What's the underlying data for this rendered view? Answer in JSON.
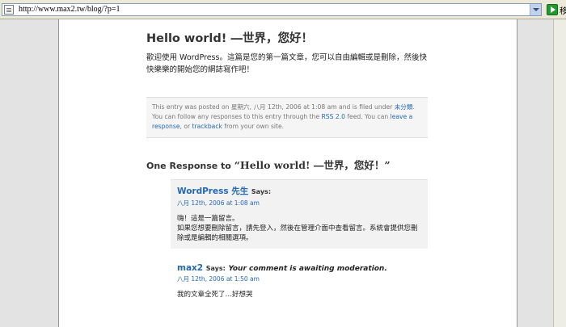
{
  "browser": {
    "url": "http://www.max2.tw/blog/?p=1",
    "go_label": "移"
  },
  "post": {
    "title": "Hello world! ―世界，您好！",
    "body": "歡迎使用 WordPress。這篇是您的第一篇文章，您可以自由編輯或是刪除，然後快快樂樂的開始您的網誌寫作吧！"
  },
  "postmeta": {
    "line1_prefix": "This entry was posted on 星期六, 八月 12th, 2006 at 1:08 am and is filed under ",
    "category": "未分類",
    "line1_suffix": ".",
    "line2_prefix": "You can follow any responses to this entry through the ",
    "rss_link": "RSS 2.0",
    "line2_mid": " feed. You can ",
    "leave_response": "leave a response",
    "line2_or": ", or ",
    "trackback": "trackback",
    "line2_suffix": " from your own site."
  },
  "responses": {
    "prefix": "One Response to ",
    "quoted_title": "“Hello world! ―世界，您好！”"
  },
  "comments": [
    {
      "author": "WordPress 先生",
      "says": "Says:",
      "date": "八月 12th, 2006 at 1:08 am",
      "lines": [
        "嗨！這是一篇留言。",
        "如果您想要刪除留言，請先登入，然後在管理介面中查看留言。系統會提供您刪除或是編輯的相關選項。"
      ]
    },
    {
      "author": "max2",
      "says": "Says:",
      "awaiting": "Your comment is awaiting moderation.",
      "date": "八月 12th, 2006 at 1:50 am",
      "lines": [
        "我的文章全死了…好想哭"
      ]
    }
  ]
}
